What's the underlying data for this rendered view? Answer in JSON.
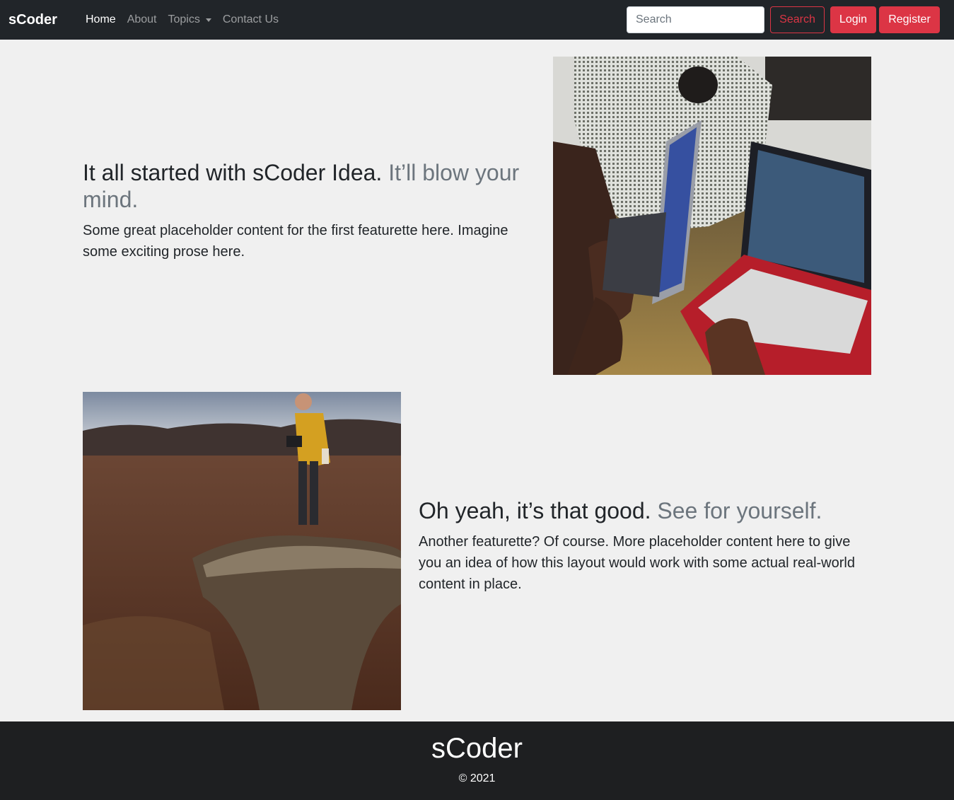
{
  "navbar": {
    "brand": "sCoder",
    "links": [
      {
        "label": "Home",
        "active": true
      },
      {
        "label": "About",
        "active": false
      },
      {
        "label": "Topics",
        "active": false,
        "dropdown": true
      },
      {
        "label": "Contact Us",
        "active": false
      }
    ],
    "search_placeholder": "Search",
    "search_button": "Search",
    "login_button": "Login",
    "register_button": "Register"
  },
  "featurettes": [
    {
      "heading": "It all started with sCoder Idea.",
      "heading_muted": "It’ll blow your mind.",
      "lead": "Some great placeholder content for the first featurette here. Imagine some exciting prose here.",
      "image": "people coding on laptops"
    },
    {
      "heading": "Oh yeah, it’s that good.",
      "heading_muted": "See for yourself.",
      "lead": "Another featurette? Of course. More placeholder content here to give you an idea of how this layout would work with some actual real-world content in place.",
      "image": "hiker with camera standing on rock in field"
    }
  ],
  "footer": {
    "brand": "sCoder",
    "copyright": "© 2021"
  },
  "colors": {
    "navbar_bg": "#212529",
    "accent_red": "#dc3545",
    "page_bg": "#f0f0f0",
    "muted_text": "#6c757d",
    "footer_bg": "#1e1f21"
  }
}
